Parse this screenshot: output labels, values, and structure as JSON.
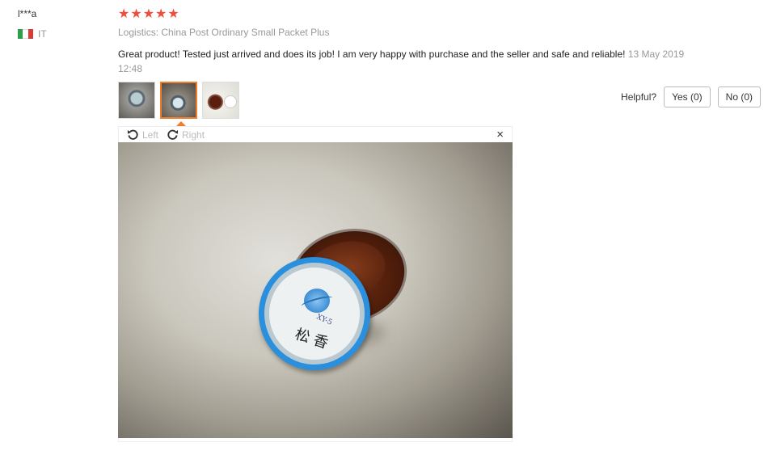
{
  "review": {
    "user": "l***a",
    "country_code": "IT",
    "stars": [
      "★",
      "★",
      "★",
      "★",
      "★"
    ],
    "logistics": "Logistics: China Post Ordinary Small Packet Plus",
    "text": "Great product! Tested just arrived and does its job! I am very happy with purchase and the seller and safe and reliable!",
    "date": "13 May 2019 12:48"
  },
  "helpful": {
    "label": "Helpful?",
    "yes": "Yes (0)",
    "no": "No (0)"
  },
  "viewer": {
    "rotate_left": "Left",
    "rotate_right": "Right",
    "close": "×",
    "product_lid_text": "XY-5",
    "product_lid_chinese": "松 香"
  },
  "colors": {
    "star": "#f04d3d",
    "active_thumb": "#f07d2a",
    "lid_ring": "#2a8fdc"
  },
  "icons": {
    "rotate_left": "rotate-left-icon",
    "rotate_right": "rotate-right-icon",
    "close": "close-icon",
    "flag": "italy-flag-icon"
  }
}
